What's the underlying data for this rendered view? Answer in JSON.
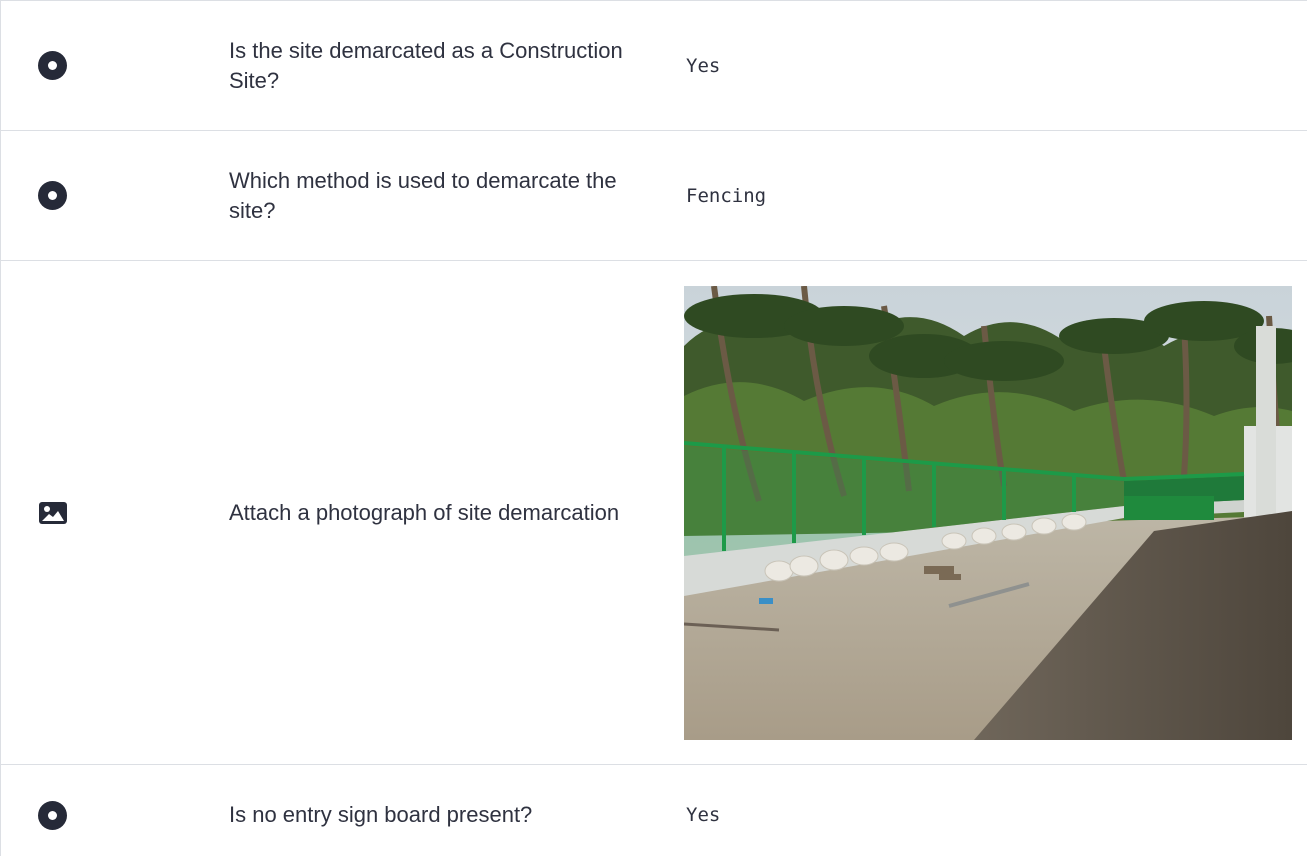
{
  "rows": [
    {
      "icon": "radio-icon",
      "question": "Is the site demarcated as a Construction Site?",
      "answer": "Yes"
    },
    {
      "icon": "radio-icon",
      "question": "Which method is used to demarcate the site?",
      "answer": "Fencing"
    },
    {
      "icon": "image-icon",
      "question": "Attach a photograph of site demarcation",
      "photo": "site-demarcation-photo"
    },
    {
      "icon": "radio-icon",
      "question": "Is no entry sign board present?",
      "answer": "Yes"
    }
  ],
  "colors": {
    "text": "#2f3240",
    "icon": "#262a38",
    "border": "#dcdfe4"
  }
}
